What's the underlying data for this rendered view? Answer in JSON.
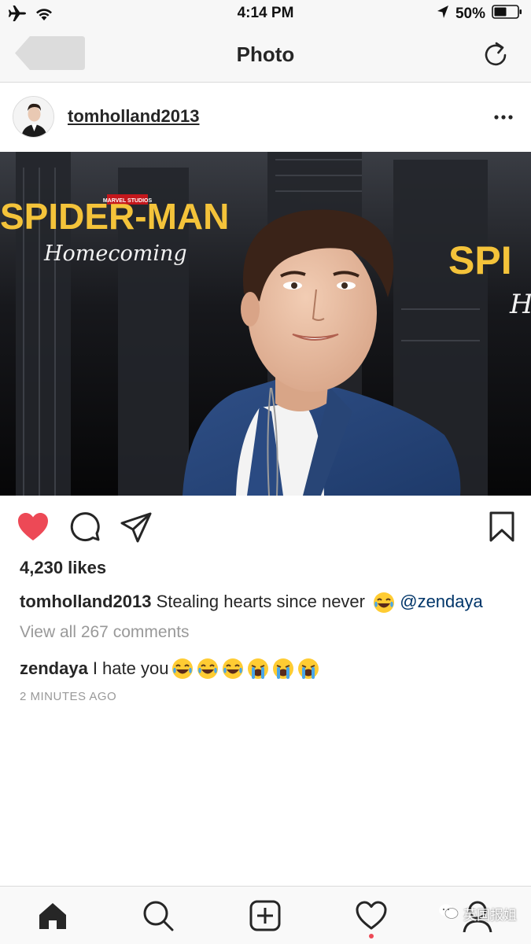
{
  "status_bar": {
    "time": "4:14 PM",
    "battery": "50%",
    "icons": [
      "airplane-mode-icon",
      "wifi-icon",
      "location-arrow-icon",
      "battery-icon"
    ]
  },
  "nav": {
    "title": "Photo",
    "icons": [
      "back-arrow-icon",
      "refresh-icon"
    ]
  },
  "post": {
    "username": "tomholland2013",
    "photo": {
      "marvel_logo": "MARVEL STUDIOS",
      "title_text": "SPIDER-MAN",
      "subtitle_text": "Homecoming",
      "right_title_text": "SPI"
    },
    "likes": "4,230 likes",
    "caption": {
      "username": "tomholland2013",
      "text": "Stealing hearts since never",
      "mention": "@zendaya"
    },
    "view_all_comments": "View all 267 comments",
    "comment": {
      "username": "zendaya",
      "text": "I hate you"
    },
    "timestamp": "2 MINUTES AGO"
  },
  "actions": {
    "icons": [
      "heart-filled-icon",
      "comment-icon",
      "share-icon",
      "bookmark-icon"
    ],
    "heart_color": "#ed4956"
  },
  "tab_bar": {
    "icons": [
      "home-icon",
      "search-icon",
      "add-post-icon",
      "activity-heart-icon",
      "profile-icon"
    ]
  },
  "watermark": {
    "text": "英国报姐"
  }
}
